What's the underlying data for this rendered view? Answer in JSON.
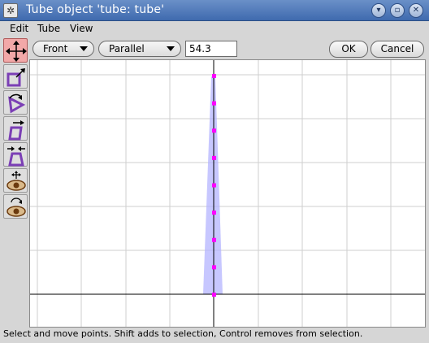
{
  "window": {
    "title": "Tube object 'tube: tube'",
    "icon": "app-icon"
  },
  "menu": [
    "Edit",
    "Tube",
    "View"
  ],
  "toolbar": {
    "tools": [
      "move-points",
      "scale-points",
      "rotate-points",
      "skew-points",
      "taper-points",
      "move-view",
      "rotate-view"
    ],
    "selected": "move-points"
  },
  "controls": {
    "view_select": "Front",
    "projection_select": "Parallel",
    "scale_value": "54.3",
    "ok_label": "OK",
    "cancel_label": "Cancel"
  },
  "viewport": {
    "grid": true,
    "tube_points": 9,
    "point_color": "#ff00ff",
    "tube_color": "#b4b4ff"
  },
  "status": {
    "text": "Select and move points.  Shift adds to selection, Control removes from selection."
  }
}
